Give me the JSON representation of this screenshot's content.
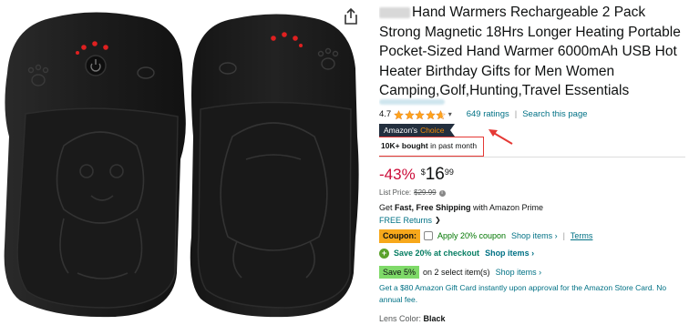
{
  "product": {
    "title": "Hand Warmers Rechargeable 2 Pack Strong Magnetic 18Hrs Longer Heating Portable Pocket-Sized Hand Warmer 6000mAh USB Hot Heater Birthday Gifts for Men Women Camping,Golf,Hunting,Travel Essentials"
  },
  "rating": {
    "value": "4.7",
    "stars": 4.7,
    "ratings_count": "649 ratings",
    "separator": "|",
    "search_page": "Search this page"
  },
  "badge": {
    "prefix": "Amazon's",
    "suffix": "Choice"
  },
  "bought": {
    "count": "10K+ bought",
    "period": "in past month"
  },
  "price": {
    "discount": "-43%",
    "currency": "$",
    "whole": "16",
    "fraction": "99",
    "list_label": "List Price:",
    "list_value": "$29.99"
  },
  "shipping": {
    "get": "Get ",
    "fast": "Fast, Free Shipping",
    "with": " with Amazon Prime",
    "returns": "FREE Returns"
  },
  "coupon": {
    "tag": "Coupon:",
    "text": "Apply 20% coupon",
    "shop": "Shop items ›",
    "sep": "|",
    "terms": "Terms"
  },
  "checkout": {
    "text": "Save 20% at checkout",
    "shop": "Shop items ›"
  },
  "save": {
    "tag": "Save 5%",
    "text": "on 2 select item(s)",
    "shop": "Shop items ›"
  },
  "giftcard": {
    "text": "Get a $80 Amazon Gift Card instantly upon approval for the Amazon Store Card. No annual fee."
  },
  "lens": {
    "label": "Lens Color: ",
    "value": "Black"
  },
  "colors": {
    "link": "#007185",
    "price_red": "#cc0c39",
    "star": "#ffa41c",
    "coupon": "#f7a81b",
    "save": "#7fda69",
    "highlight_red": "#e53935"
  },
  "icons": [
    "share-icon",
    "star-icon",
    "checkbox-icon",
    "plus-icon",
    "info-icon",
    "chevron-down-icon",
    "arrow-icon"
  ]
}
